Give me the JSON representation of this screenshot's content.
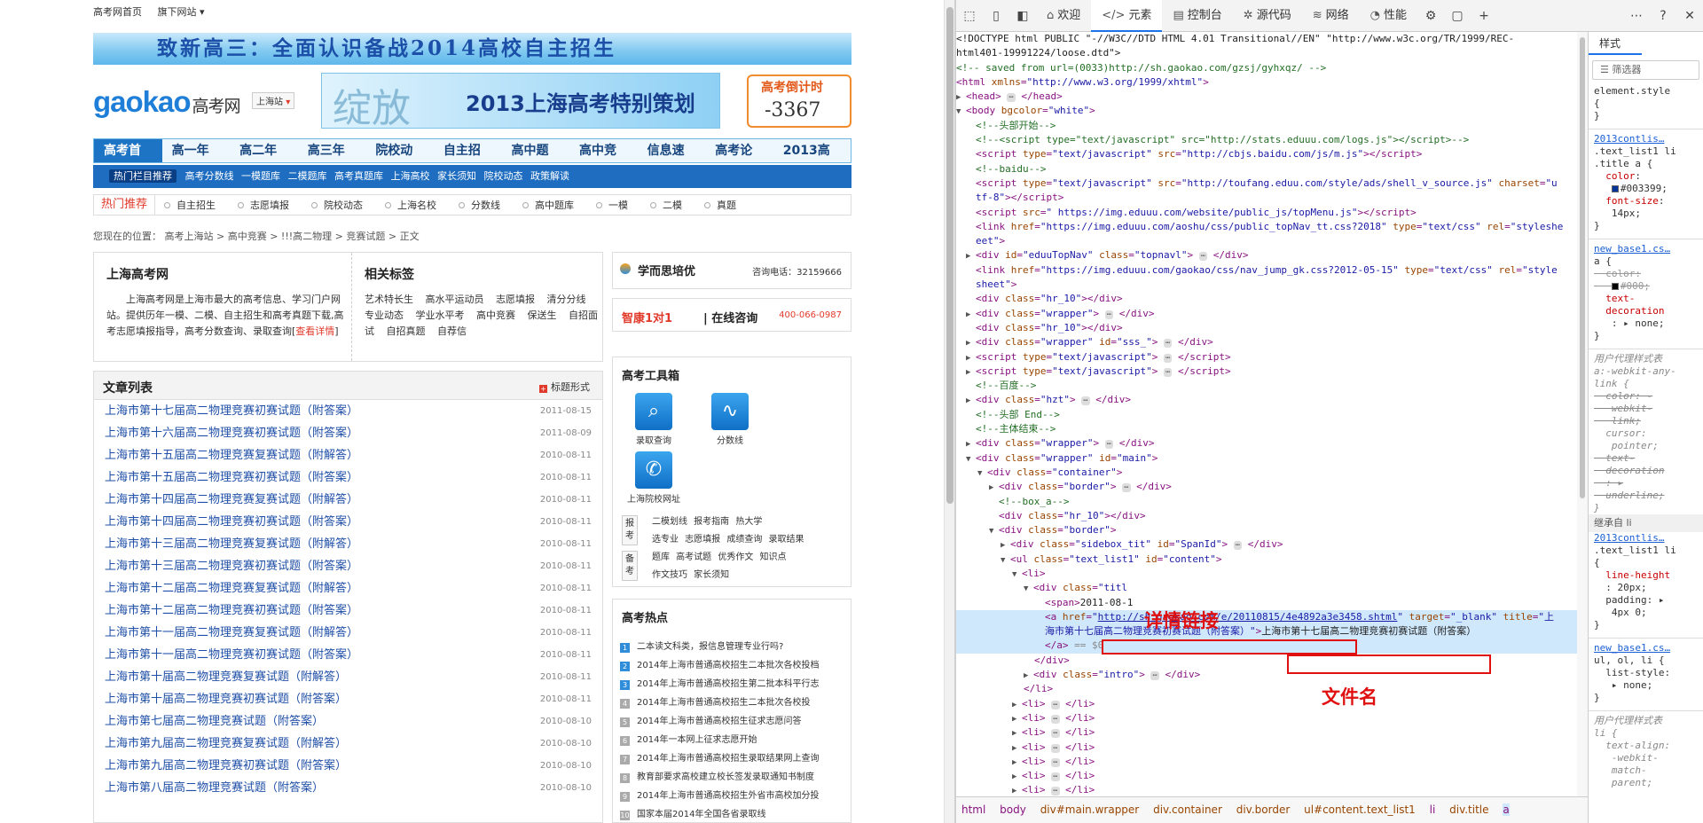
{
  "site": {
    "topbar": [
      "高考网首页",
      "旗下网站 ▾"
    ],
    "banner": "致新高三：全面认识备战2014高校自主招生",
    "logo": "gaokao",
    "logo_cn": "高考网",
    "city": "上海站",
    "ad_big": "绽放",
    "ad_text": "2013上海高考特别策划",
    "countdown_title": "高考倒计时",
    "countdown_value": "-3367",
    "nav": [
      "高考首页",
      "高一年级",
      "高二年级",
      "高三年级",
      "院校动态",
      "自主招生",
      "高中题库",
      "高中竞赛",
      "信息速查",
      "高考论坛",
      "2013高考"
    ],
    "hot_label": "热门栏目推荐",
    "hot_items": [
      "高考分数线",
      "一模题库",
      "二模题库",
      "高考真题库",
      "上海高校",
      "家长须知",
      "院校动态",
      "政策解读"
    ],
    "rec_label": "热门推荐",
    "rec_items": [
      "自主招生",
      "志愿填报",
      "院校动态",
      "上海名校",
      "分数线",
      "高中题库",
      "一模",
      "二模",
      "真题"
    ],
    "breadcrumb": "您现在的位置： 高考上海站 > 高中竞赛 > !!!高二物理 > 竞赛试题 > 正文",
    "intro_title": "上海高考网",
    "intro_text": "上海高考网是上海市最大的高考信息、学习门户网站。提供历年一模、二模、自主招生和高考真题下载,高考志愿填报指导，高考分数查询、录取查询[",
    "intro_more": "查看详情",
    "intro_end": "]",
    "tags_title": "相关标签",
    "tags": "艺术特长生 高水平运动员 志愿填报 清分分线 专业动态 学业水平考 高中竞赛 保送生 自招面试 自招真题 自荐信",
    "list_title": "文章列表",
    "list_switch": "标题形式",
    "articles": [
      {
        "title": "上海市第十七届高二物理竞赛初赛试题（附答案）",
        "date": "2011-08-15"
      },
      {
        "title": "上海市第十六届高二物理竞赛初赛试题（附答案）",
        "date": "2011-08-09"
      },
      {
        "title": "上海市第十五届高二物理竞赛复赛试题（附解答）",
        "date": "2010-08-11"
      },
      {
        "title": "上海市第十五届高二物理竞赛初赛试题（附答案）",
        "date": "2010-08-11"
      },
      {
        "title": "上海市第十四届高二物理竞赛复赛试题（附解答）",
        "date": "2010-08-11"
      },
      {
        "title": "上海市第十四届高二物理竞赛初赛试题（附答案）",
        "date": "2010-08-11"
      },
      {
        "title": "上海市第十三届高二物理竞赛复赛试题（附解答）",
        "date": "2010-08-11"
      },
      {
        "title": "上海市第十三届高二物理竞赛初赛试题（附答案）",
        "date": "2010-08-11"
      },
      {
        "title": "上海市第十二届高二物理竞赛复赛试题（附解答）",
        "date": "2010-08-11"
      },
      {
        "title": "上海市第十二届高二物理竞赛初赛试题（附答案）",
        "date": "2010-08-11"
      },
      {
        "title": "上海市第十一届高二物理竞赛复赛试题（附解答）",
        "date": "2010-08-11"
      },
      {
        "title": "上海市第十一届高二物理竞赛初赛试题（附答案）",
        "date": "2010-08-11"
      },
      {
        "title": "上海市第十届高二物理竞赛复赛试题（附解答）",
        "date": "2010-08-11"
      },
      {
        "title": "上海市第十届高二物理竞赛初赛试题（附答案）",
        "date": "2010-08-11"
      },
      {
        "title": "上海市第七届高二物理竞赛试题（附答案）",
        "date": "2010-08-10"
      },
      {
        "title": "上海市第九届高二物理竞赛复赛试题（附解答）",
        "date": "2010-08-10"
      },
      {
        "title": "上海市第九届高二物理竞赛初赛试题（附答案）",
        "date": "2010-08-10"
      },
      {
        "title": "上海市第八届高二物理竞赛试题（附答案）",
        "date": "2010-08-10"
      }
    ],
    "xue_title": "学而思培优",
    "xue_tel": "咨询电话：32159666",
    "consult_a": "智康1对1",
    "consult_b": "| 在线咨询",
    "consult_tel": "400-066-0987",
    "tools_title": "高考工具箱",
    "tool1": "录取查询",
    "tool2": "分数线",
    "tool3": "上海院校网址",
    "bao_label": "报考",
    "bao_row1": "二模划线 报考指南 热大学",
    "bao_row2": "选专业 志愿填报 成绩查询 录取结果",
    "bei_label": "备考",
    "bei_row1": "题库 高考试题 优秀作文 知识点",
    "bei_row2": "作文技巧 家长须知",
    "hotnews_title": "高考热点",
    "hotnews": [
      "二本读文科类，报信息管理专业行吗?",
      "2014年上海市普通高校招生二本批次各校投档",
      "2014年上海市普通高校招生第二批本科平行志",
      "2014年上海市普通高校招生二本批次各校投",
      "2014年上海市普通高校招生征求志愿问答",
      "2014年一本网上征求志愿开始",
      "2014年上海市普通高校招生录取结果网上查询",
      "教育部要求高校建立校长签发录取通知书制度",
      "2014年上海市普通高校招生外省市高校加分投",
      "国家本届2014年全国各省录取线"
    ]
  },
  "devtools": {
    "tabs": [
      "欢迎",
      "元素",
      "控制台",
      "源代码",
      "网络",
      "性能"
    ],
    "active_tab": "元素",
    "annotation_link": "详情链接",
    "annotation_file": "文件名",
    "breadcrumb": [
      "html",
      "body",
      "div#main.wrapper",
      "div.container",
      "div.border",
      "ul#content.text_list1",
      "li",
      "div.title",
      "a"
    ],
    "styles_tab": "样式",
    "filter_placeholder": "筛选器",
    "inherited_label": "继承自 li"
  }
}
